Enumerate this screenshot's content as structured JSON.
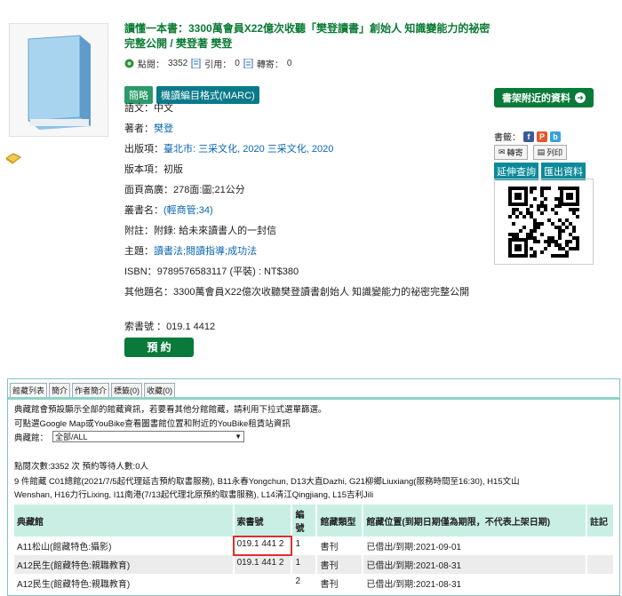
{
  "book": {
    "title": "讀懂一本書：3300萬會員X22億次收聽「樊登讀書」創始人 知識變能力的祕密完整公開 / 樊登著 樊登",
    "stats": {
      "clicks_label": "點閱：",
      "clicks": "3352",
      "cite_label": "引用：",
      "cite": "0",
      "forward_label": "轉寄：",
      "forward": "0"
    }
  },
  "detail_tabs": [
    "簡略",
    "機讀編目格式(MARC)"
  ],
  "fields": {
    "language": {
      "label": "語文：",
      "value": "中文"
    },
    "author": {
      "label": "著者：",
      "value": "樊登"
    },
    "publisher": {
      "label": "出版項：",
      "value": "臺北市: 三采文化, 2020 三采文化, 2020"
    },
    "edition": {
      "label": "版本項：",
      "value": "初版"
    },
    "pages": {
      "label": "面頁高廣：",
      "value": "278面:圖;21公分"
    },
    "series": {
      "label": "叢書名：",
      "value": "(輕商管;34)"
    },
    "note": {
      "label": "附註：",
      "value": "附錄: 給未來讀書人的一封信"
    },
    "subject": {
      "label": "主題：",
      "value": "讀書法;閱讀指導;成功法"
    },
    "isbn": {
      "label": "ISBN：",
      "value": "9789576583117 (平裝) : NT$380"
    },
    "other_title": {
      "label": "其他題名：",
      "value": "3300萬會員X22億次收聽樊登讀書創始人 知識變能力的祕密完整公開"
    },
    "callno": {
      "label": "索書號 ：",
      "value": "019.1 4412"
    }
  },
  "reserve_label": "預 約",
  "side": {
    "nearby": "書架附近的資料",
    "bookmark_label": "書籤：",
    "mail": "轉寄",
    "print": "列印",
    "ext_query": "延伸查詢",
    "export": "匯出資料"
  },
  "holdings": {
    "tabs": [
      "館藏列表",
      "簡介",
      "作者簡介",
      "標籤(0)",
      "收藏(0)"
    ],
    "notice_red": "典藏館會預設顯示全部的館藏資訊，若要看其他分館館藏，請利用下拉式選單篩選。",
    "notice_red2": "可點選Google Map或YouBike查看圖書館位置和附近的YouBike租賃站資訊",
    "branch_label": "典藏館：",
    "branch_selected": "全部/ALL",
    "stats_line": "點閱次數:3352 次 預約等待人數:0人",
    "availability_line1": "9 件館藏 C01總館(2021/7/5起代理延吉預約取書服務), B11永春Yongchun, D13大直Dazhi, G21柳鄉Liuxiang(服務時間至16:30), H15文山",
    "availability_line2": "Wenshan, H16力行Lixing, I11南港(7/13起代理北原預約取書服務), L14清江Qingjiang, L15吉利Jili",
    "columns": [
      "典藏館",
      "索書號",
      "編號",
      "館藏類型",
      "館藏位置(到期日期僅為期限，不代表上架日期)",
      "註記"
    ],
    "rows": [
      {
        "branch": "A11松山(館藏特色:攝影)",
        "callno": "019.1 441 2",
        "no": "1",
        "type": "書刊",
        "status": "已借出/到期:2021-09-01",
        "note": ""
      },
      {
        "branch": "A12民生(館藏特色:親職教育)",
        "callno": "019.1 441 2",
        "no": "1",
        "type": "書刊",
        "status": "已借出/到期:2021-08-31",
        "note": ""
      },
      {
        "branch": "A12民生(館藏特色:親職教育)",
        "callno": "",
        "no": "2",
        "type": "書刊",
        "status": "已借出/到期:2021-08-31",
        "note": ""
      }
    ]
  }
}
